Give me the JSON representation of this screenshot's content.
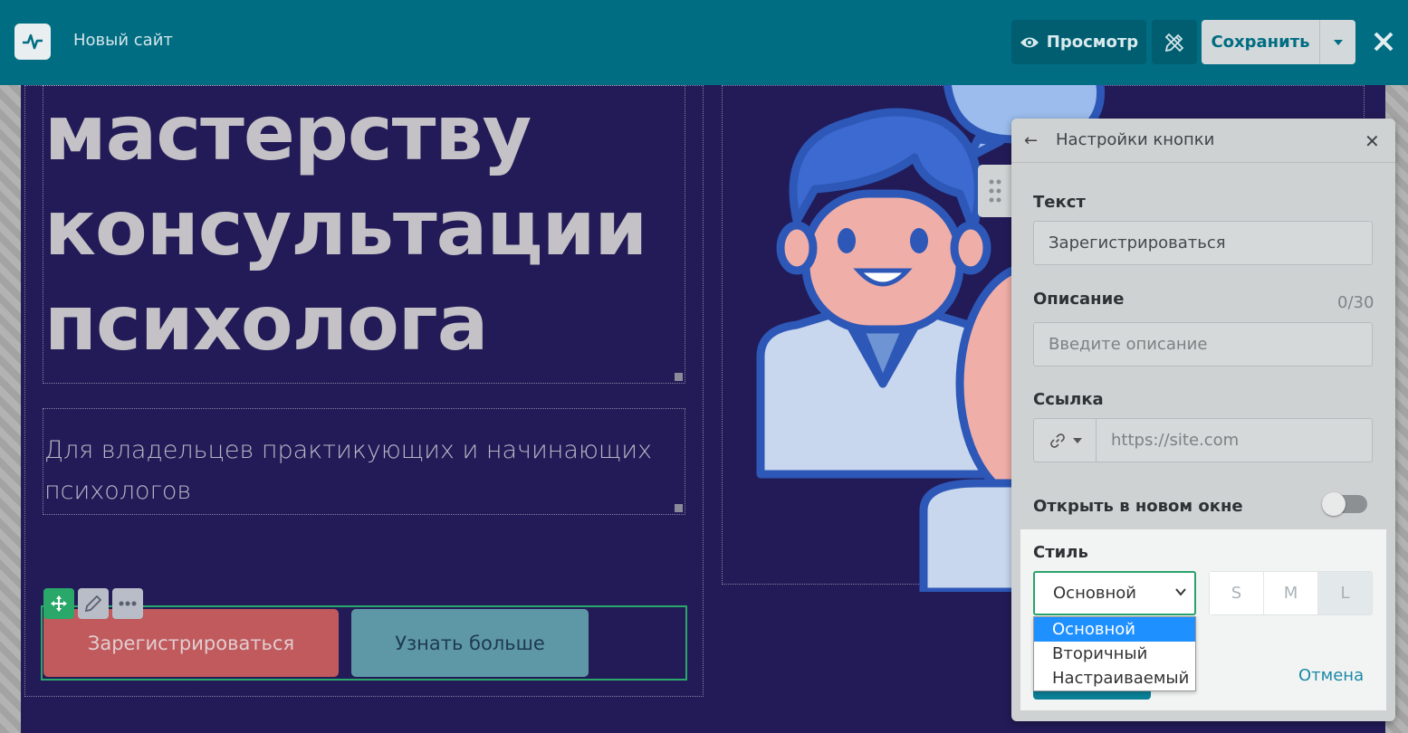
{
  "topbar": {
    "site_name": "Новый сайт",
    "preview_label": "Просмотр",
    "save_label": "Сохранить"
  },
  "hero": {
    "headline_lines": [
      "мастерству",
      "консультации",
      "психолога"
    ],
    "subtitle_lines": [
      "Для владельцев практикующих и начинающих",
      "психологов"
    ],
    "primary_button": "Зарегистрироваться",
    "secondary_button": "Узнать больше"
  },
  "panel": {
    "title": "Настройки кнопки",
    "text_label": "Текст",
    "text_value": "Зарегистрироваться",
    "description_label": "Описание",
    "description_counter": "0/30",
    "description_placeholder": "Введите описание",
    "link_label": "Ссылка",
    "link_placeholder": "https://site.com",
    "new_window_label": "Открыть в новом окне",
    "new_window_enabled": false,
    "style_label": "Стиль",
    "style_selected": "Основной",
    "style_options": [
      "Основной",
      "Вторичный",
      "Настраиваемый"
    ],
    "sizes": [
      "S",
      "M",
      "L"
    ],
    "size_selected": "L",
    "cancel_label": "Отмена"
  },
  "colors": {
    "topbar": "#006d82",
    "hero_bg": "#221b57",
    "primary_button": "#c05a5c",
    "secondary_button": "#5e98a7",
    "accent_green": "#29a36b",
    "dropdown_highlight": "#1e90ff"
  }
}
